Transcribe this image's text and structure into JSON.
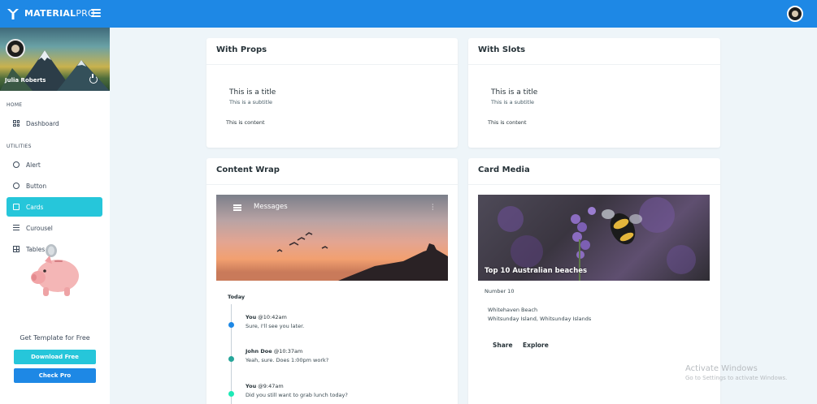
{
  "app": {
    "brand_bold": "MATERIAL",
    "brand_light": "PRO"
  },
  "sidebar": {
    "user_name": "Julia Roberts",
    "sections": {
      "home": "HOME",
      "utilities": "UTILITIES"
    },
    "items": [
      {
        "label": "Dashboard",
        "icon": "dashboard-icon"
      },
      {
        "label": "Alert",
        "icon": "alert-circle-icon"
      },
      {
        "label": "Button",
        "icon": "button-circle-icon"
      },
      {
        "label": "Cards",
        "icon": "cards-icon",
        "active": true
      },
      {
        "label": "Curousel",
        "icon": "sliders-icon"
      },
      {
        "label": "Tables",
        "icon": "table-icon"
      }
    ],
    "promo_text": "Get Template for Free",
    "download_label": "Download Free",
    "check_label": "Check Pro"
  },
  "cards": {
    "props": {
      "header": "With Props",
      "title": "This is a title",
      "subtitle": "This is a subtitle",
      "content": "This is content"
    },
    "slots": {
      "header": "With Slots",
      "title": "This is a title",
      "subtitle": "This is a subtitle",
      "content": "This is content"
    },
    "content_wrap": {
      "header": "Content Wrap",
      "toolbar_title": "Messages",
      "timeline_heading": "Today",
      "messages": [
        {
          "name": "You",
          "time": "@10:42am",
          "text": "Sure, I'll see you later.",
          "color": "#1e88e5"
        },
        {
          "name": "John Doe",
          "time": "@10:37am",
          "text": "Yeah, sure. Does 1:00pm work?",
          "color": "#26a69a"
        },
        {
          "name": "You",
          "time": "@9:47am",
          "text": "Did you still want to grab lunch today?",
          "color": "#1de9b6"
        }
      ]
    },
    "media": {
      "header": "Card Media",
      "caption": "Top 10 Australian beaches",
      "subtitle": "Number 10",
      "line1": "Whitehaven Beach",
      "line2": "Whitsunday Island, Whitsunday Islands",
      "share_label": "Share",
      "explore_label": "Explore"
    }
  },
  "watermark": {
    "title": "Activate Windows",
    "subtitle": "Go to Settings to activate Windows."
  },
  "colors": {
    "topbar": "#1e88e5",
    "active_nav": "#26c6da"
  }
}
